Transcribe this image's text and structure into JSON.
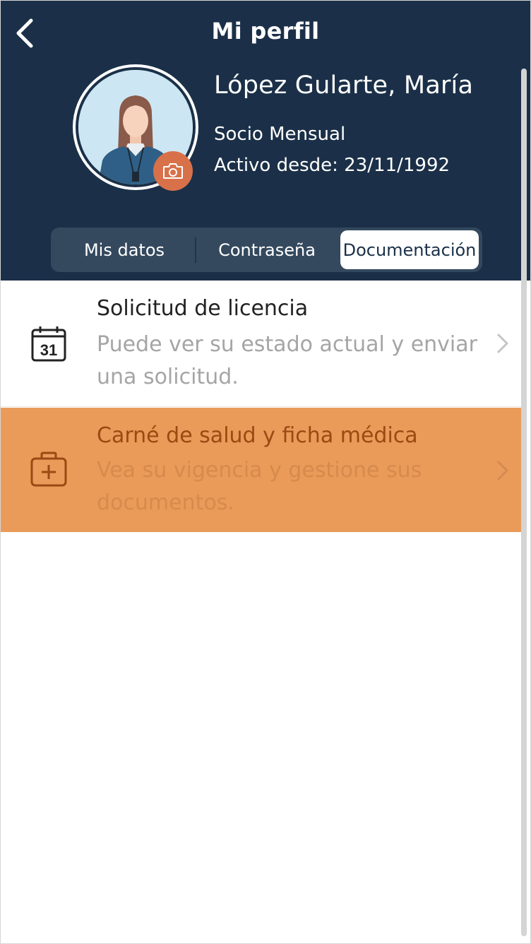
{
  "header": {
    "title": "Mi perfil",
    "back_icon": "chevron-left-icon"
  },
  "profile": {
    "name": "López Gularte, María",
    "membership": "Socio Mensual",
    "active_since": "Activo desde: 23/11/1992",
    "camera_icon": "camera-icon"
  },
  "tabs": [
    {
      "label": "Mis datos",
      "active": false
    },
    {
      "label": "Contraseña",
      "active": false
    },
    {
      "label": "Documentación",
      "active": true
    }
  ],
  "items": [
    {
      "title": "Solicitud de licencia",
      "description": "Puede ver su estado actual y enviar una solicitud.",
      "icon": "calendar-icon",
      "icon_text": "31",
      "highlighted": false
    },
    {
      "title": "Carné de salud y ficha médica",
      "description": "Vea su vigencia y gestione sus documentos.",
      "icon": "medical-kit-icon",
      "highlighted": true
    }
  ],
  "colors": {
    "header_bg": "#1b3048",
    "segmented_bg": "#34495e",
    "camera_accent": "#d8714a",
    "highlight_bg": "#ea9b59",
    "highlight_text": "#9a4a12"
  }
}
